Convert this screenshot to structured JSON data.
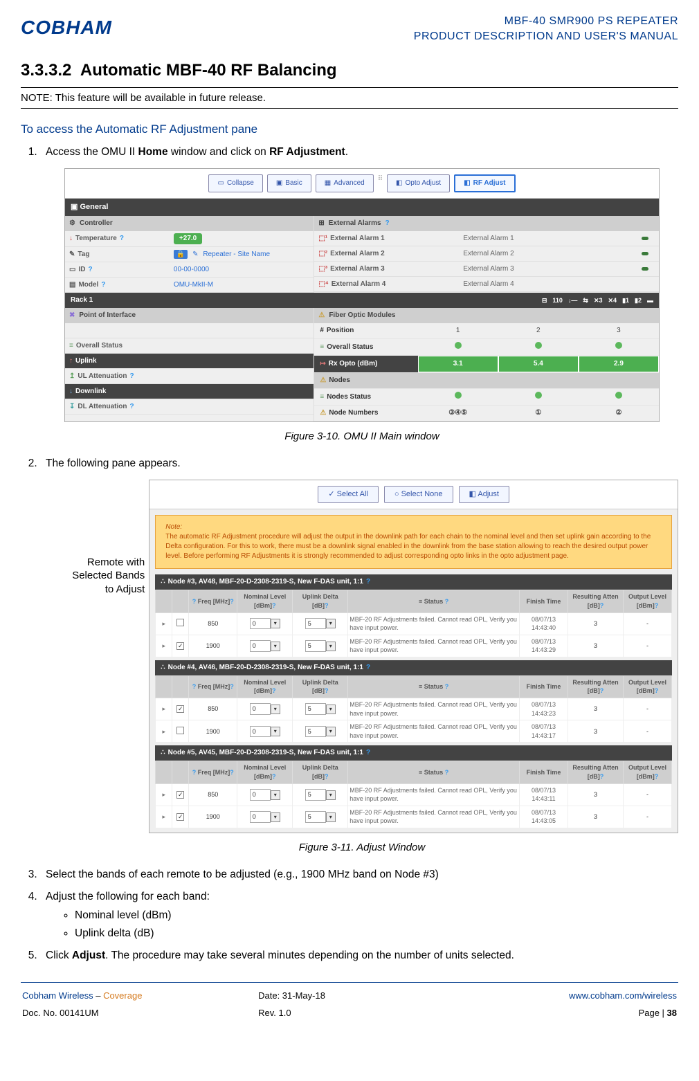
{
  "header": {
    "logo": "COBHAM",
    "title_line1": "MBF-40 SMR900 PS REPEATER",
    "title_line2": "PRODUCT DESCRIPTION AND USER'S MANUAL"
  },
  "section_number": "3.3.3.2",
  "section_title": "Automatic MBF-40 RF Balancing",
  "note_text": "NOTE: This feature will be available in future release.",
  "sub_heading": "To access the Automatic RF Adjustment pane",
  "step1": {
    "text_pre": "Access the OMU II ",
    "bold1": "Home",
    "text_mid": " window and click on ",
    "bold2": "RF Adjustment",
    "text_post": "."
  },
  "screenshot1": {
    "toolbar": {
      "collapse": "Collapse",
      "basic": "Basic",
      "advanced": "Advanced",
      "opto": "Opto Adjust",
      "rf": "RF Adjust"
    },
    "general_title": "General",
    "controller_title": "Controller",
    "ext_alarms_title": "External Alarms",
    "rows_left": {
      "temp_label": "Temperature",
      "temp_val": "+27.0",
      "tag_label": "Tag",
      "tag_val": "Repeater - Site Name",
      "id_label": "ID",
      "id_val": "00-00-0000",
      "model_label": "Model",
      "model_val": "OMU-MkII-M"
    },
    "ext_alarms": {
      "a1_label": "External Alarm 1",
      "a1_val": "External Alarm 1",
      "a2_label": "External Alarm 2",
      "a2_val": "External Alarm 2",
      "a3_label": "External Alarm 3",
      "a3_val": "External Alarm 3",
      "a4_label": "External Alarm 4",
      "a4_val": "External Alarm 4"
    },
    "rack_title": "Rack 1",
    "poi_title": "Point of Interface",
    "fiber_title": "Fiber Optic Modules",
    "poi_rows": {
      "overall": "Overall Status",
      "uplink": "Uplink",
      "ul_atten": "UL Attenuation",
      "downlink": "Downlink",
      "dl_atten": "DL Attenuation"
    },
    "fiber_rows": {
      "position": "Position",
      "pos1": "1",
      "pos2": "2",
      "pos3": "3",
      "overall": "Overall Status",
      "rx": "Rx Opto (dBm)",
      "rx1": "3.1",
      "rx2": "5.4",
      "rx3": "2.9",
      "nodes": "Nodes",
      "node_status": "Nodes Status",
      "node_numbers": "Node Numbers",
      "nn1": "③④⑤",
      "nn2": "①",
      "nn3": "②"
    }
  },
  "fig1_caption": "Figure 3-10. OMU II Main window",
  "step2_text": "The following pane appears.",
  "annotation": "Remote with Selected Bands to Adjust",
  "screenshot2": {
    "toolbar": {
      "select_all": "Select All",
      "select_none": "Select None",
      "adjust": "Adjust"
    },
    "note_title": "Note:",
    "note_body": "The automatic RF Adjustment procedure will adjust the output in the downlink path for each chain to the nominal level and then set uplink gain according to the Delta configuration. For this to work, there must be a downlink signal enabled in the downlink from the base station allowing to reach the desired output power level. Before performing RF Adjustments it is strongly recommended to adjust corresponding opto links in the opto adjustment page.",
    "columns": {
      "freq": "Freq [MHz]",
      "nominal": "Nominal Level [dBm]",
      "uplink": "Uplink Delta [dB]",
      "status": "Status",
      "finish": "Finish Time",
      "result_atten": "Resulting Atten [dB]",
      "output": "Output Level [dBm]"
    },
    "nodes": [
      {
        "title": "Node #3, AV48, MBF-20-D-2308-2319-S, New F-DAS unit, 1:1",
        "rows": [
          {
            "checked": false,
            "freq": "850",
            "nominal": "0",
            "uplink": "5",
            "status": "MBF-20 RF Adjustments failed. Cannot read OPL, Verify you have input power.",
            "finish": "08/07/13 14:43:40",
            "atten": "3",
            "output": "-"
          },
          {
            "checked": true,
            "freq": "1900",
            "nominal": "0",
            "uplink": "5",
            "status": "MBF-20 RF Adjustments failed. Cannot read OPL, Verify you have input power.",
            "finish": "08/07/13 14:43:29",
            "atten": "3",
            "output": "-"
          }
        ]
      },
      {
        "title": "Node #4, AV46, MBF-20-D-2308-2319-S, New F-DAS unit, 1:1",
        "rows": [
          {
            "checked": true,
            "freq": "850",
            "nominal": "0",
            "uplink": "5",
            "status": "MBF-20 RF Adjustments failed. Cannot read OPL, Verify you have input power.",
            "finish": "08/07/13 14:43:23",
            "atten": "3",
            "output": "-"
          },
          {
            "checked": false,
            "freq": "1900",
            "nominal": "0",
            "uplink": "5",
            "status": "MBF-20 RF Adjustments failed. Cannot read OPL, Verify you have input power.",
            "finish": "08/07/13 14:43:17",
            "atten": "3",
            "output": "-"
          }
        ]
      },
      {
        "title": "Node #5, AV45, MBF-20-D-2308-2319-S, New F-DAS unit, 1:1",
        "rows": [
          {
            "checked": true,
            "freq": "850",
            "nominal": "0",
            "uplink": "5",
            "status": "MBF-20 RF Adjustments failed. Cannot read OPL, Verify you have input power.",
            "finish": "08/07/13 14:43:11",
            "atten": "3",
            "output": "-"
          },
          {
            "checked": true,
            "freq": "1900",
            "nominal": "0",
            "uplink": "5",
            "status": "MBF-20 RF Adjustments failed. Cannot read OPL, Verify you have input power.",
            "finish": "08/07/13 14:43:05",
            "atten": "3",
            "output": "-"
          }
        ]
      }
    ]
  },
  "fig2_caption": "Figure 3-11. Adjust Window",
  "step3_text": "Select the bands of each remote to be adjusted (e.g., 1900 MHz band on Node #3)",
  "step4_text": "Adjust the following for each band:",
  "step4_bullets": {
    "b1": "Nominal level (dBm)",
    "b2": "Uplink delta (dB)"
  },
  "step5": {
    "pre": "Click ",
    "bold": "Adjust",
    "post": ". The procedure may take several minutes depending on the number of units selected."
  },
  "footer": {
    "left1a": "Cobham Wireless",
    "left1b": " – ",
    "left1c": "Coverage",
    "left2": "Doc. No. 00141UM",
    "mid1": "Date: 31-May-18",
    "mid2": "Rev. 1.0",
    "right1": "www.cobham.com/wireless",
    "right2a": "Page | ",
    "right2b": "38"
  }
}
